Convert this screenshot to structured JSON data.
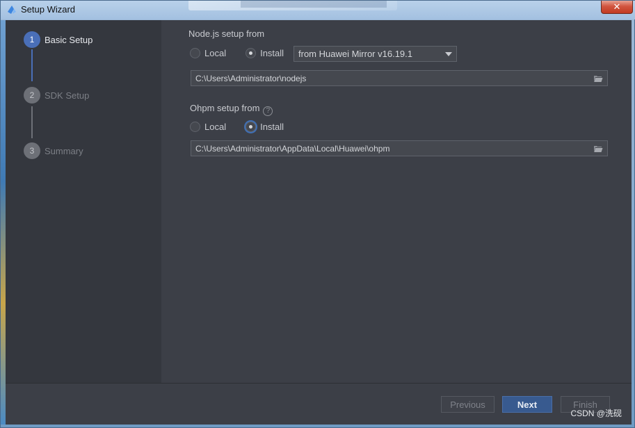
{
  "window": {
    "title": "Setup Wizard",
    "close_glyph": "✕"
  },
  "steps": [
    {
      "number": "1",
      "label": "Basic Setup",
      "active": true
    },
    {
      "number": "2",
      "label": "SDK Setup",
      "active": false
    },
    {
      "number": "3",
      "label": "Summary",
      "active": false
    }
  ],
  "nodejs": {
    "label": "Node.js setup from",
    "options": [
      "Local",
      "Install"
    ],
    "selected": "Install",
    "mirror_value": "from Huawei Mirror v16.19.1",
    "path": "C:\\Users\\Administrator\\nodejs"
  },
  "ohpm": {
    "label": "Ohpm setup from",
    "help_glyph": "?",
    "options": [
      "Local",
      "Install"
    ],
    "selected": "Install",
    "path": "C:\\Users\\Administrator\\AppData\\Local\\Huawei\\ohpm"
  },
  "footer": {
    "previous_label": "Previous",
    "next_label": "Next",
    "finish_label": "Finish"
  },
  "watermark": "CSDN @洗砚",
  "colors": {
    "accent": "#4a6fb8",
    "primary_button": "#385a8f",
    "background": "#3c3f47",
    "sidebar": "#34373e"
  },
  "icons": {
    "app": "deveco-logo-icon",
    "folder": "folder-open-icon",
    "help": "question-circle-icon",
    "dropdown": "chevron-down-icon"
  }
}
